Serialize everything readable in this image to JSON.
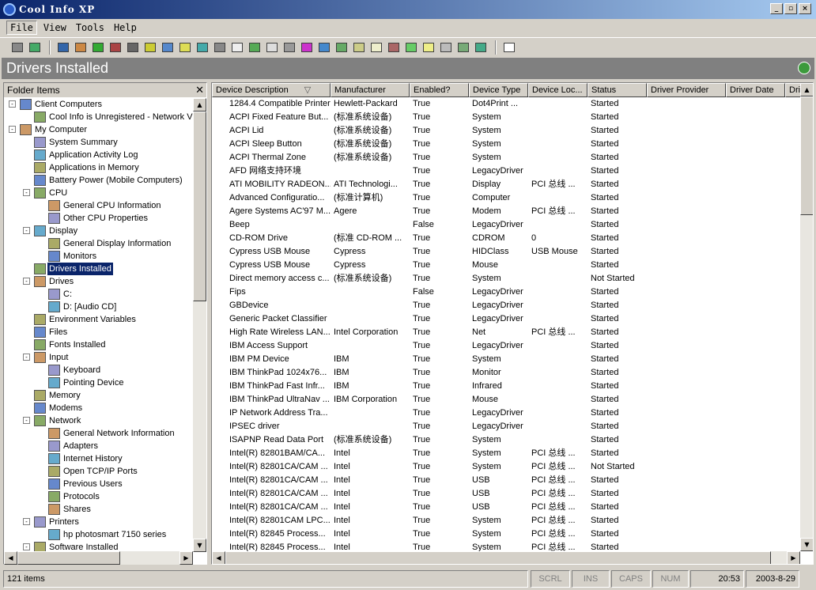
{
  "window": {
    "title": "Cool Info XP",
    "buttons": [
      "_",
      "▫",
      "×"
    ]
  },
  "menu": [
    "File",
    "View",
    "Tools",
    "Help"
  ],
  "toolbar_icons": [
    "printer-icon",
    "plug-icon",
    "computer-icon",
    "monitor-icon",
    "chip-icon",
    "app-icon",
    "usb-icon",
    "cd-icon",
    "disk-icon",
    "folder-icon",
    "network-icon",
    "printer2-icon",
    "modem-icon",
    "ram-icon",
    "mouse-icon",
    "keyboard-icon",
    "font-icon",
    "driver-icon",
    "env-icon",
    "file-icon",
    "history-icon",
    "users-icon",
    "protocol-icon",
    "share-icon",
    "sound-icon",
    "hardware-icon",
    "app2-icon",
    "help-icon"
  ],
  "page_header": "Drivers Installed",
  "left_pane": {
    "title": "Folder Items",
    "tree": [
      {
        "label": "Client Computers",
        "level": 0,
        "exp": "-"
      },
      {
        "label": "Cool Info is Unregistered - Network V",
        "level": 1,
        "exp": ""
      },
      {
        "label": "My Computer",
        "level": 0,
        "exp": "-"
      },
      {
        "label": "System Summary",
        "level": 1,
        "exp": ""
      },
      {
        "label": "Application Activity Log",
        "level": 1,
        "exp": ""
      },
      {
        "label": "Applications in Memory",
        "level": 1,
        "exp": ""
      },
      {
        "label": "Battery Power (Mobile Computers)",
        "level": 1,
        "exp": ""
      },
      {
        "label": "CPU",
        "level": 1,
        "exp": "-"
      },
      {
        "label": "General CPU Information",
        "level": 2,
        "exp": ""
      },
      {
        "label": "Other CPU Properties",
        "level": 2,
        "exp": ""
      },
      {
        "label": "Display",
        "level": 1,
        "exp": "-"
      },
      {
        "label": "General Display Information",
        "level": 2,
        "exp": ""
      },
      {
        "label": "Monitors",
        "level": 2,
        "exp": ""
      },
      {
        "label": "Drivers Installed",
        "level": 1,
        "exp": "",
        "selected": true
      },
      {
        "label": "Drives",
        "level": 1,
        "exp": "-"
      },
      {
        "label": "C:",
        "level": 2,
        "exp": ""
      },
      {
        "label": "D: [Audio CD]",
        "level": 2,
        "exp": ""
      },
      {
        "label": "Environment Variables",
        "level": 1,
        "exp": ""
      },
      {
        "label": "Files",
        "level": 1,
        "exp": ""
      },
      {
        "label": "Fonts Installed",
        "level": 1,
        "exp": ""
      },
      {
        "label": "Input",
        "level": 1,
        "exp": "-"
      },
      {
        "label": "Keyboard",
        "level": 2,
        "exp": ""
      },
      {
        "label": "Pointing Device",
        "level": 2,
        "exp": ""
      },
      {
        "label": "Memory",
        "level": 1,
        "exp": ""
      },
      {
        "label": "Modems",
        "level": 1,
        "exp": ""
      },
      {
        "label": "Network",
        "level": 1,
        "exp": "-"
      },
      {
        "label": "General Network Information",
        "level": 2,
        "exp": ""
      },
      {
        "label": "Adapters",
        "level": 2,
        "exp": ""
      },
      {
        "label": "Internet History",
        "level": 2,
        "exp": ""
      },
      {
        "label": "Open TCP/IP Ports",
        "level": 2,
        "exp": ""
      },
      {
        "label": "Previous Users",
        "level": 2,
        "exp": ""
      },
      {
        "label": "Protocols",
        "level": 2,
        "exp": ""
      },
      {
        "label": "Shares",
        "level": 2,
        "exp": ""
      },
      {
        "label": "Printers",
        "level": 1,
        "exp": "-"
      },
      {
        "label": "hp photosmart 7150 series",
        "level": 2,
        "exp": ""
      },
      {
        "label": "Software Installed",
        "level": 1,
        "exp": "-"
      }
    ]
  },
  "table": {
    "columns": [
      "Device Description",
      "Manufacturer",
      "Enabled?",
      "Device Type",
      "Device Loc...",
      "Status",
      "Driver Provider",
      "Driver Date",
      "Dri"
    ],
    "sort_indicator": "▽",
    "rows": [
      [
        "1284.4 Compatible Printer",
        "Hewlett-Packard",
        "True",
        "Dot4Print ...",
        "",
        "Started"
      ],
      [
        "ACPI Fixed Feature But...",
        "(标准系统设备)",
        "True",
        "System",
        "",
        "Started"
      ],
      [
        "ACPI Lid",
        "(标准系统设备)",
        "True",
        "System",
        "",
        "Started"
      ],
      [
        "ACPI Sleep Button",
        "(标准系统设备)",
        "True",
        "System",
        "",
        "Started"
      ],
      [
        "ACPI Thermal Zone",
        "(标准系统设备)",
        "True",
        "System",
        "",
        "Started"
      ],
      [
        "AFD 网络支持环境",
        "",
        "True",
        "LegacyDriver",
        "",
        "Started"
      ],
      [
        "ATI MOBILITY RADEON...",
        "ATI Technologi...",
        "True",
        "Display",
        "PCI 总线 ...",
        "Started"
      ],
      [
        "Advanced Configuratio...",
        "(标准计算机)",
        "True",
        "Computer",
        "",
        "Started"
      ],
      [
        "Agere Systems AC'97 M...",
        "Agere",
        "True",
        "Modem",
        "PCI 总线 ...",
        "Started"
      ],
      [
        "Beep",
        "",
        "False",
        "LegacyDriver",
        "",
        "Started"
      ],
      [
        "CD-ROM Drive",
        "(标准 CD-ROM ...",
        "True",
        "CDROM",
        "0",
        "Started"
      ],
      [
        "Cypress USB Mouse",
        "Cypress",
        "True",
        "HIDClass",
        "USB Mouse",
        "Started"
      ],
      [
        "Cypress USB Mouse",
        "Cypress",
        "True",
        "Mouse",
        "",
        "Started"
      ],
      [
        "Direct memory access c...",
        "(标准系统设备)",
        "True",
        "System",
        "",
        "Not Started"
      ],
      [
        "Fips",
        "",
        "False",
        "LegacyDriver",
        "",
        "Started"
      ],
      [
        "GBDevice",
        "",
        "True",
        "LegacyDriver",
        "",
        "Started"
      ],
      [
        "Generic Packet Classifier",
        "",
        "True",
        "LegacyDriver",
        "",
        "Started"
      ],
      [
        "High Rate Wireless LAN...",
        "Intel Corporation",
        "True",
        "Net",
        "PCI 总线 ...",
        "Started"
      ],
      [
        "IBM Access Support",
        "",
        "True",
        "LegacyDriver",
        "",
        "Started"
      ],
      [
        "IBM PM Device",
        "IBM",
        "True",
        "System",
        "",
        "Started"
      ],
      [
        "IBM ThinkPad 1024x76...",
        "IBM",
        "True",
        "Monitor",
        "",
        "Started"
      ],
      [
        "IBM ThinkPad Fast Infr...",
        "IBM",
        "True",
        "Infrared",
        "",
        "Started"
      ],
      [
        "IBM ThinkPad UltraNav ...",
        "IBM Corporation",
        "True",
        "Mouse",
        "",
        "Started"
      ],
      [
        "IP Network Address Tra...",
        "",
        "True",
        "LegacyDriver",
        "",
        "Started"
      ],
      [
        "IPSEC driver",
        "",
        "True",
        "LegacyDriver",
        "",
        "Started"
      ],
      [
        "ISAPNP Read Data Port",
        "(标准系统设备)",
        "True",
        "System",
        "",
        "Started"
      ],
      [
        "Intel(R) 82801BAM/CA...",
        "Intel",
        "True",
        "System",
        "PCI 总线 ...",
        "Started"
      ],
      [
        "Intel(R) 82801CA/CAM ...",
        "Intel",
        "True",
        "System",
        "PCI 总线 ...",
        "Not Started"
      ],
      [
        "Intel(R) 82801CA/CAM ...",
        "Intel",
        "True",
        "USB",
        "PCI 总线 ...",
        "Started"
      ],
      [
        "Intel(R) 82801CA/CAM ...",
        "Intel",
        "True",
        "USB",
        "PCI 总线 ...",
        "Started"
      ],
      [
        "Intel(R) 82801CA/CAM ...",
        "Intel",
        "True",
        "USB",
        "PCI 总线 ...",
        "Started"
      ],
      [
        "Intel(R) 82801CAM LPC...",
        "Intel",
        "True",
        "System",
        "PCI 总线 ...",
        "Started"
      ],
      [
        "Intel(R) 82845 Process...",
        "Intel",
        "True",
        "System",
        "PCI 总线 ...",
        "Started"
      ],
      [
        "Intel(R) 82845 Process...",
        "Intel",
        "True",
        "System",
        "PCI 总线 ...",
        "Started"
      ]
    ]
  },
  "status": {
    "count": "121 items",
    "scrl": "SCRL",
    "ins": "INS",
    "caps": "CAPS",
    "num": "NUM",
    "time": "20:53",
    "date": "2003-8-29"
  }
}
